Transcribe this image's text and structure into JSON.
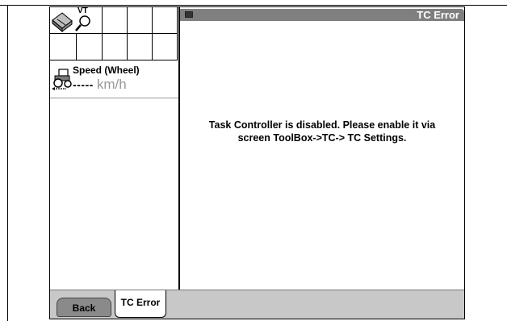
{
  "grid": {
    "vt_icon": "vt-pen-tool-icon",
    "vt_label": "VT"
  },
  "speed": {
    "label": "Speed (Wheel)",
    "value": "-----",
    "unit": "km/h",
    "icon": "tractor-speed-icon"
  },
  "window": {
    "title": "TC Error",
    "icon": "window-icon"
  },
  "message": {
    "line1": "Task Controller is disabled. Please enable it via",
    "line2": "screen ToolBox->TC-> TC Settings."
  },
  "tabs": {
    "back_label": "Back",
    "active_label": "TC Error"
  },
  "colors": {
    "titlebar": "#7f7f7f",
    "tabbar": "#c8c8c8",
    "back_button": "#8a8a8a"
  }
}
